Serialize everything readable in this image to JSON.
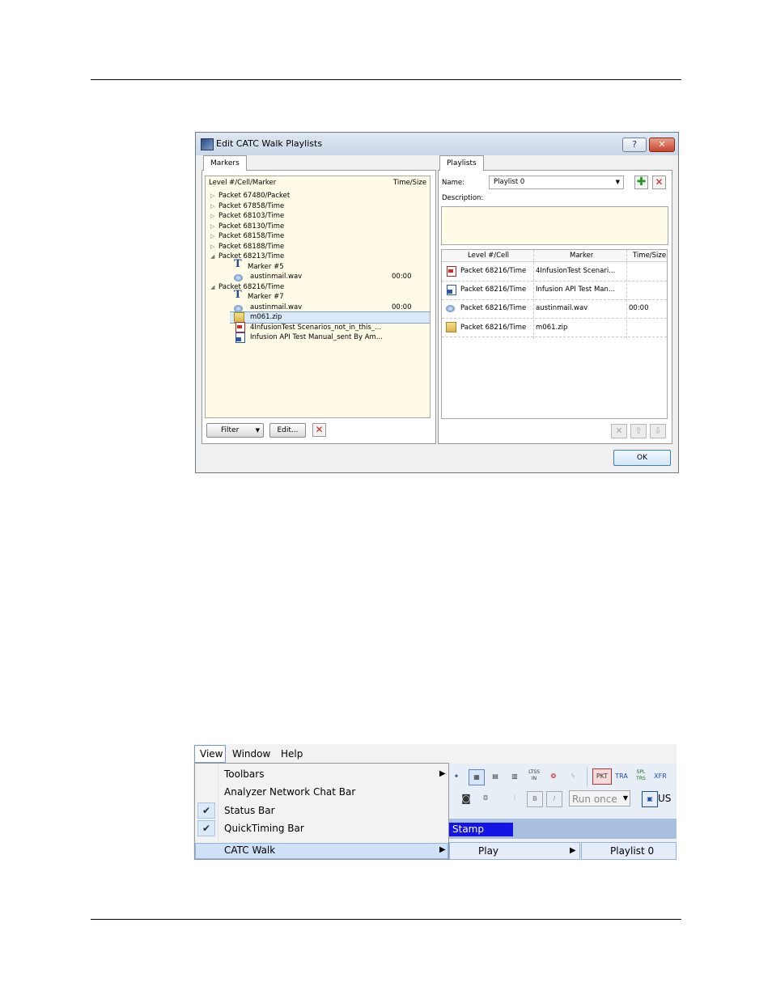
{
  "dialog": {
    "title": "Edit CATC Walk Playlists",
    "help_label": "?",
    "close_label": "✕",
    "ok_label": "OK"
  },
  "markers": {
    "tab_label": "Markers",
    "col_level": "Level #/Cell/Marker",
    "col_time": "Time/Size",
    "rows": [
      {
        "label": "Packet 67480/Packet",
        "time": ""
      },
      {
        "label": "Packet 67858/Time",
        "time": ""
      },
      {
        "label": "Packet 68103/Time",
        "time": ""
      },
      {
        "label": "Packet 68130/Time",
        "time": ""
      },
      {
        "label": "Packet 68158/Time",
        "time": ""
      },
      {
        "label": "Packet 68188/Time",
        "time": ""
      },
      {
        "label": "Packet 68213/Time",
        "time": ""
      },
      {
        "label": "Marker #5",
        "time": ""
      },
      {
        "label": "austinmail.wav",
        "time": "00:00"
      },
      {
        "label": "Packet 68216/Time",
        "time": ""
      },
      {
        "label": "Marker #7",
        "time": ""
      },
      {
        "label": "austinmail.wav",
        "time": "00:00"
      },
      {
        "label": "m061.zip",
        "time": ""
      },
      {
        "label": "4InfusionTest Scenarios_not_in_this_...",
        "time": ""
      },
      {
        "label": "Infusion API Test Manual_sent By Am...",
        "time": ""
      }
    ],
    "filter_label": "Filter",
    "edit_label": "Edit..."
  },
  "playlists": {
    "tab_label": "Playlists",
    "name_label": "Name:",
    "name_value": "Playlist 0",
    "description_label": "Description:",
    "col_level": "Level #/Cell",
    "col_marker": "Marker",
    "col_time": "Time/Size",
    "rows": [
      {
        "icon": "pdf-icon",
        "level": "Packet 68216/Time",
        "marker": "4InfusionTest Scenari...",
        "time": ""
      },
      {
        "icon": "doc-icon",
        "level": "Packet 68216/Time",
        "marker": "Infusion API Test Man...",
        "time": ""
      },
      {
        "icon": "audio-icon",
        "level": "Packet 68216/Time",
        "marker": "austinmail.wav",
        "time": "00:00"
      },
      {
        "icon": "zip-icon",
        "level": "Packet 68216/Time",
        "marker": "m061.zip",
        "time": ""
      }
    ]
  },
  "menu": {
    "bar": [
      "View",
      "Window",
      "Help"
    ],
    "items": [
      {
        "label": "Toolbars",
        "checked": false,
        "submenu": true
      },
      {
        "label": "Analyzer Network Chat Bar",
        "checked": false,
        "submenu": false
      },
      {
        "label": "Status Bar",
        "checked": true,
        "submenu": false
      },
      {
        "label": "QuickTiming Bar",
        "checked": true,
        "submenu": false
      },
      {
        "label": "CATC Walk",
        "checked": false,
        "submenu": true
      }
    ],
    "submenu_play": "Play",
    "submenu_playlist": "Playlist 0",
    "run_once": "Run once",
    "stamp": "Stamp",
    "toolbar_labels": [
      "PKT",
      "TRA",
      "SPL TRS",
      "XFR",
      "LTSS IN",
      "US"
    ]
  }
}
